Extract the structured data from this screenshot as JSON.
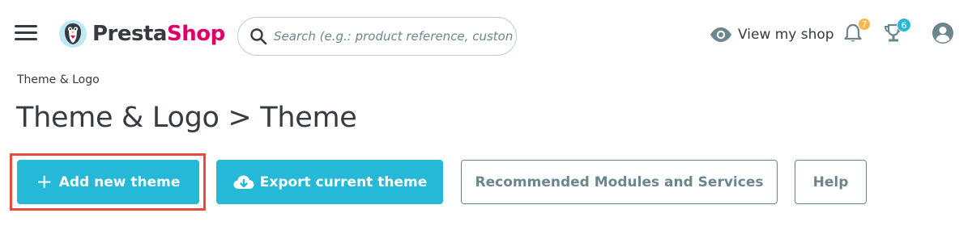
{
  "header": {
    "logo": {
      "presta": "Presta",
      "shop": "Shop"
    },
    "search": {
      "placeholder": "Search (e.g.: product reference, custon"
    },
    "view_shop_label": "View my shop",
    "notifications_count": "7",
    "achievements_count": "6"
  },
  "breadcrumb": "Theme & Logo",
  "page_title": "Theme & Logo > Theme",
  "toolbar": {
    "add_theme_label": "Add new theme",
    "export_theme_label": "Export current theme",
    "recommended_label": "Recommended Modules and Services",
    "help_label": "Help"
  },
  "colors": {
    "primary": "#25b9d7",
    "brand_pink": "#df0067",
    "text": "#363a41",
    "outline": "#6c868e",
    "highlight": "#e64b3c",
    "notif_badge": "#ffb74d"
  },
  "icons": [
    "menu-icon",
    "prestashop-logo",
    "search-icon",
    "eye-icon",
    "bell-icon",
    "trophy-icon",
    "user-avatar-icon",
    "plus-icon",
    "cloud-download-icon"
  ]
}
